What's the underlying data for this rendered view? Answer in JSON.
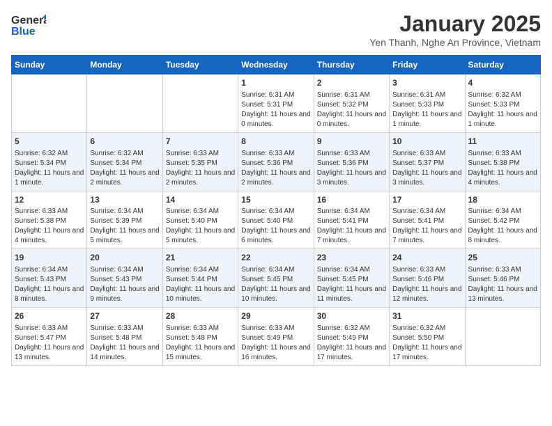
{
  "header": {
    "logo_general": "General",
    "logo_blue": "Blue",
    "title": "January 2025",
    "subtitle": "Yen Thanh, Nghe An Province, Vietnam"
  },
  "calendar": {
    "days_of_week": [
      "Sunday",
      "Monday",
      "Tuesday",
      "Wednesday",
      "Thursday",
      "Friday",
      "Saturday"
    ],
    "weeks": [
      [
        {
          "day": "",
          "info": ""
        },
        {
          "day": "",
          "info": ""
        },
        {
          "day": "",
          "info": ""
        },
        {
          "day": "1",
          "info": "Sunrise: 6:31 AM\nSunset: 5:31 PM\nDaylight: 11 hours and 0 minutes."
        },
        {
          "day": "2",
          "info": "Sunrise: 6:31 AM\nSunset: 5:32 PM\nDaylight: 11 hours and 0 minutes."
        },
        {
          "day": "3",
          "info": "Sunrise: 6:31 AM\nSunset: 5:33 PM\nDaylight: 11 hours and 1 minute."
        },
        {
          "day": "4",
          "info": "Sunrise: 6:32 AM\nSunset: 5:33 PM\nDaylight: 11 hours and 1 minute."
        }
      ],
      [
        {
          "day": "5",
          "info": "Sunrise: 6:32 AM\nSunset: 5:34 PM\nDaylight: 11 hours and 1 minute."
        },
        {
          "day": "6",
          "info": "Sunrise: 6:32 AM\nSunset: 5:34 PM\nDaylight: 11 hours and 2 minutes."
        },
        {
          "day": "7",
          "info": "Sunrise: 6:33 AM\nSunset: 5:35 PM\nDaylight: 11 hours and 2 minutes."
        },
        {
          "day": "8",
          "info": "Sunrise: 6:33 AM\nSunset: 5:36 PM\nDaylight: 11 hours and 2 minutes."
        },
        {
          "day": "9",
          "info": "Sunrise: 6:33 AM\nSunset: 5:36 PM\nDaylight: 11 hours and 3 minutes."
        },
        {
          "day": "10",
          "info": "Sunrise: 6:33 AM\nSunset: 5:37 PM\nDaylight: 11 hours and 3 minutes."
        },
        {
          "day": "11",
          "info": "Sunrise: 6:33 AM\nSunset: 5:38 PM\nDaylight: 11 hours and 4 minutes."
        }
      ],
      [
        {
          "day": "12",
          "info": "Sunrise: 6:33 AM\nSunset: 5:38 PM\nDaylight: 11 hours and 4 minutes."
        },
        {
          "day": "13",
          "info": "Sunrise: 6:34 AM\nSunset: 5:39 PM\nDaylight: 11 hours and 5 minutes."
        },
        {
          "day": "14",
          "info": "Sunrise: 6:34 AM\nSunset: 5:40 PM\nDaylight: 11 hours and 5 minutes."
        },
        {
          "day": "15",
          "info": "Sunrise: 6:34 AM\nSunset: 5:40 PM\nDaylight: 11 hours and 6 minutes."
        },
        {
          "day": "16",
          "info": "Sunrise: 6:34 AM\nSunset: 5:41 PM\nDaylight: 11 hours and 7 minutes."
        },
        {
          "day": "17",
          "info": "Sunrise: 6:34 AM\nSunset: 5:41 PM\nDaylight: 11 hours and 7 minutes."
        },
        {
          "day": "18",
          "info": "Sunrise: 6:34 AM\nSunset: 5:42 PM\nDaylight: 11 hours and 8 minutes."
        }
      ],
      [
        {
          "day": "19",
          "info": "Sunrise: 6:34 AM\nSunset: 5:43 PM\nDaylight: 11 hours and 8 minutes."
        },
        {
          "day": "20",
          "info": "Sunrise: 6:34 AM\nSunset: 5:43 PM\nDaylight: 11 hours and 9 minutes."
        },
        {
          "day": "21",
          "info": "Sunrise: 6:34 AM\nSunset: 5:44 PM\nDaylight: 11 hours and 10 minutes."
        },
        {
          "day": "22",
          "info": "Sunrise: 6:34 AM\nSunset: 5:45 PM\nDaylight: 11 hours and 10 minutes."
        },
        {
          "day": "23",
          "info": "Sunrise: 6:34 AM\nSunset: 5:45 PM\nDaylight: 11 hours and 11 minutes."
        },
        {
          "day": "24",
          "info": "Sunrise: 6:33 AM\nSunset: 5:46 PM\nDaylight: 11 hours and 12 minutes."
        },
        {
          "day": "25",
          "info": "Sunrise: 6:33 AM\nSunset: 5:46 PM\nDaylight: 11 hours and 13 minutes."
        }
      ],
      [
        {
          "day": "26",
          "info": "Sunrise: 6:33 AM\nSunset: 5:47 PM\nDaylight: 11 hours and 13 minutes."
        },
        {
          "day": "27",
          "info": "Sunrise: 6:33 AM\nSunset: 5:48 PM\nDaylight: 11 hours and 14 minutes."
        },
        {
          "day": "28",
          "info": "Sunrise: 6:33 AM\nSunset: 5:48 PM\nDaylight: 11 hours and 15 minutes."
        },
        {
          "day": "29",
          "info": "Sunrise: 6:33 AM\nSunset: 5:49 PM\nDaylight: 11 hours and 16 minutes."
        },
        {
          "day": "30",
          "info": "Sunrise: 6:32 AM\nSunset: 5:49 PM\nDaylight: 11 hours and 17 minutes."
        },
        {
          "day": "31",
          "info": "Sunrise: 6:32 AM\nSunset: 5:50 PM\nDaylight: 11 hours and 17 minutes."
        },
        {
          "day": "",
          "info": ""
        }
      ]
    ]
  }
}
